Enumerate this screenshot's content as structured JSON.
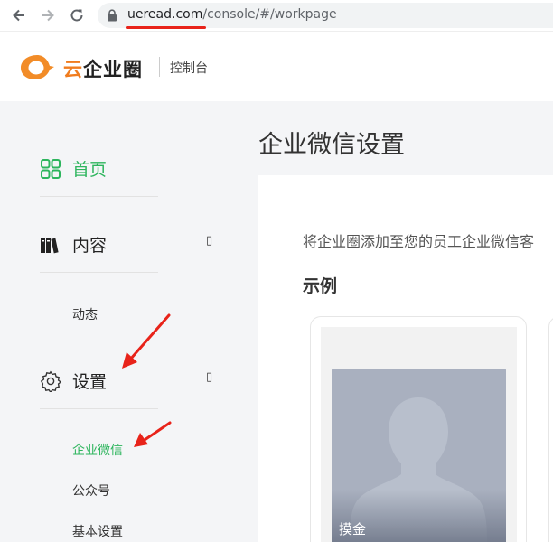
{
  "browser": {
    "url_host": "ueread.com",
    "url_path": "/console/#/workpage"
  },
  "header": {
    "logo_first_char": "云",
    "logo_rest": "企业圈",
    "console_label": "控制台"
  },
  "sidebar": {
    "items": [
      {
        "label": "首页",
        "icon": "grid-icon",
        "active": true
      },
      {
        "label": "内容",
        "icon": "books-icon",
        "arrow": "▯"
      },
      {
        "label": "设置",
        "icon": "gear-icon",
        "arrow": "▯"
      }
    ],
    "content_subitems": [
      "动态"
    ],
    "settings_subitems": [
      {
        "label": "企业微信",
        "active": true
      },
      {
        "label": "公众号"
      },
      {
        "label": "基本设置"
      }
    ]
  },
  "main": {
    "title": "企业微信设置",
    "description": "将企业圈添加至您的员工企业微信客",
    "example_heading": "示例",
    "example_name": "摸金"
  },
  "colors": {
    "accent_green": "#2db55d",
    "logo_orange": "#f07c1e",
    "annotation_red": "#e8231a"
  }
}
